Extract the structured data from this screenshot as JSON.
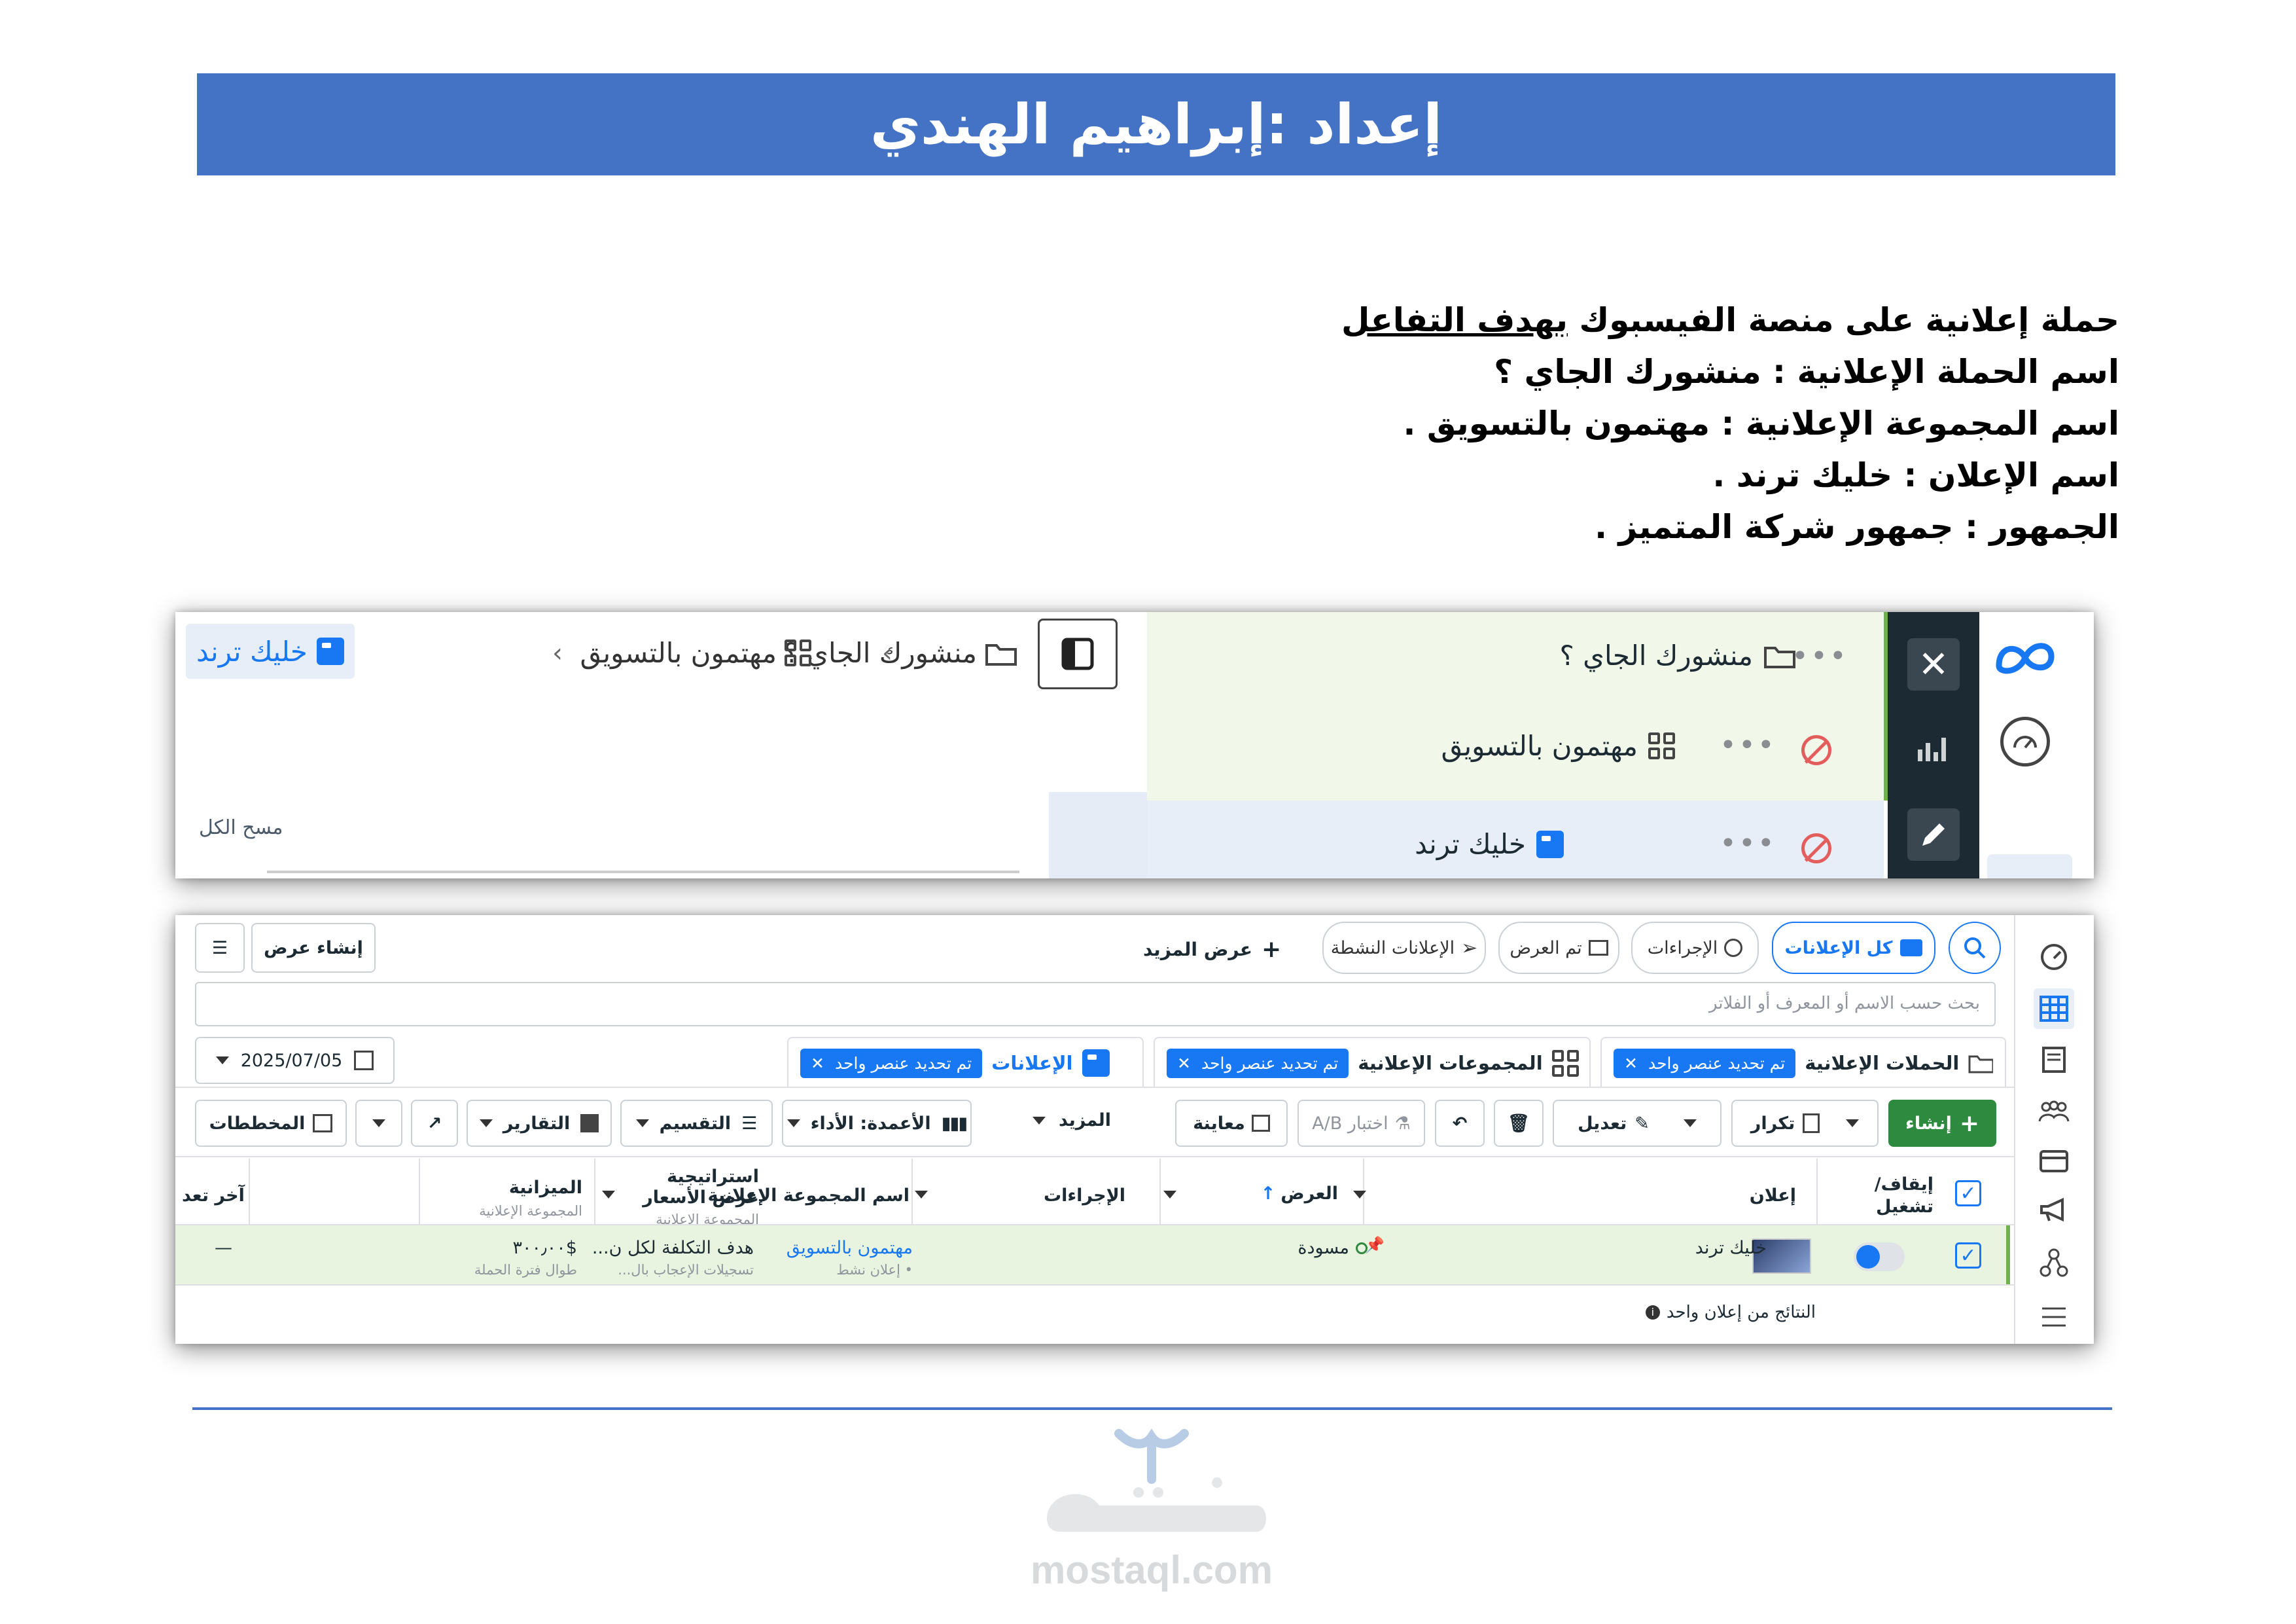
{
  "header": {
    "title": "إعداد :إبراهيم الهندي"
  },
  "brief": {
    "line1_prefix": "حملة إعلانية على منصة الفيسبوك ",
    "line1_emph": "بهدف التفاعل",
    "line2": "اسم الحملة الإعلانية : منشورك الجاي ؟",
    "line3": "اسم المجموعة الإعلانية : مهتمون بالتسويق .",
    "line4": "اسم الإعلان : خليك ترند .",
    "line5": "الجمهور : جمهور شركة المتميز ."
  },
  "editor": {
    "breadcrumb": {
      "campaign": "منشورك الجاي ؟",
      "adset": "مهتمون بالتسويق",
      "ad": "خليك ترند"
    },
    "clear_all": "مسح الكل",
    "tree": {
      "campaign": "منشورك الجاي ؟",
      "adset": "مهتمون بالتسويق",
      "ad": "خليك ترند"
    }
  },
  "manager": {
    "filters": {
      "all_ads": "كل الإعلانات",
      "actions": "الإجراءات",
      "viewed": "تم العرض",
      "active_ads": "الإعلانات النشطة",
      "more_views": "عرض المزيد",
      "create_view": "إنشاء عرض"
    },
    "search": {
      "placeholder": "بحث حسب الاسم أو المعرف أو الفلاتر"
    },
    "date": "2025/07/05",
    "tabs": {
      "campaigns": "الحملات الإعلانية",
      "adsets": "المجموعات الإعلانية",
      "ads": "الإعلانات",
      "selected_chip": "تم تحديد عنصر واحد"
    },
    "toolbar": {
      "create": "إنشاء",
      "duplicate": "تكرار",
      "edit": "تعديل",
      "ab_test": "اختبار A/B",
      "preview": "معاينة",
      "more": "المزيد",
      "columns": "الأعمدة: الأداء",
      "breakdown": "التقسيم",
      "reports": "التقارير",
      "charts": "المخططات"
    },
    "table": {
      "headers": {
        "onoff": "إيقاف/ تشغيل",
        "ad": "إعلان",
        "delivery": "العرض",
        "actions": "الإجراءات",
        "adset_name": "اسم المجموعة الإعلانية",
        "bid_strategy": "استراتيجية عرض الأسعار",
        "bid_strategy_sub": "المجموعة الإعلانية",
        "budget": "الميزانية",
        "budget_sub": "المجموعة الإعلانية",
        "last_edit": "آخر تعد"
      },
      "row": {
        "ad": "خليك ترند",
        "delivery": "مسودة",
        "adset_name": "مهتمون بالتسويق",
        "adset_sub": "• إعلان نشط",
        "bid": "هدف التكلفة لكل ن...",
        "bid_sub": "تسجيلات الإعجاب بال...",
        "budget": "$٣٠٠٫٠٠",
        "budget_sub": "طوال فترة الحملة",
        "last_edit": "—"
      },
      "footer": "النتائج من إعلان واحد"
    }
  },
  "watermark": {
    "domain": "mostaql.com"
  }
}
